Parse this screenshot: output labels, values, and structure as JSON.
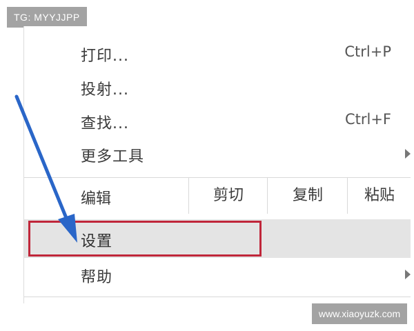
{
  "watermarks": {
    "top_left": "TG: MYYJJPP",
    "bottom_right": "www.xiaoyuzk.com"
  },
  "menu": {
    "items": [
      {
        "label": "打印...",
        "shortcut": "Ctrl+P"
      },
      {
        "label": "投射...",
        "shortcut": ""
      },
      {
        "label": "查找...",
        "shortcut": "Ctrl+F"
      },
      {
        "label": "更多工具",
        "shortcut": ""
      }
    ],
    "edit": {
      "label": "编辑",
      "cut": "剪切",
      "copy": "复制",
      "paste": "粘贴"
    },
    "settings": {
      "label": "设置"
    },
    "help": {
      "label": "帮助"
    }
  },
  "colors": {
    "highlight_border": "#c0263a",
    "arrow": "#2a66c8",
    "selected_row": "#e4e4e4"
  },
  "icons": {
    "annotation_arrow": "blue-arrow-icon",
    "submenu": "chevron-right-icon"
  }
}
